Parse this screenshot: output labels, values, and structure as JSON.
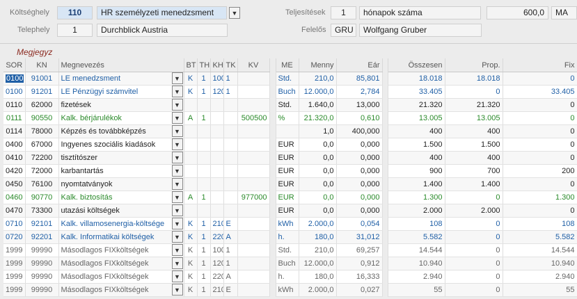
{
  "header": {
    "cost_center_label": "Költséghely",
    "cost_center_code": "110",
    "cost_center_name": "HR személyzeti menedzsment",
    "site_label": "Telephely",
    "site_code": "1",
    "site_name": "Durchblick Austria",
    "performance_label": "Teljesítések",
    "performance_value": "1",
    "performance_unit_name": "hónapok száma",
    "performance_amount": "600,0",
    "performance_unit": "MA",
    "responsible_label": "Felelős",
    "responsible_code": "GRU",
    "responsible_name": "Wolfgang Gruber"
  },
  "note_label": "Megjegyz",
  "columns": [
    "SOR",
    "KN",
    "Megnevezés",
    "BT",
    "TH",
    "KH",
    "TK",
    "KV",
    "ME",
    "Menny",
    "Eár",
    "Összesen",
    "Prop.",
    "Fix"
  ],
  "rows": [
    {
      "sor": "0100",
      "kn": "91001",
      "name": "LE menedzsment",
      "bt": "K",
      "th": "1",
      "kh": "100",
      "tk": "1",
      "kv": "",
      "me": "Std.",
      "menny": "210,0",
      "ear": "85,801",
      "osszesen": "18.018",
      "prop": "18.018",
      "fix": "0",
      "color": "blue",
      "sel": true
    },
    {
      "sor": "0100",
      "kn": "91201",
      "name": "LE Pénzügyi számvitel",
      "bt": "K",
      "th": "1",
      "kh": "120",
      "tk": "1",
      "kv": "",
      "me": "Buch",
      "menny": "12.000,0",
      "ear": "2,784",
      "osszesen": "33.405",
      "prop": "0",
      "fix": "33.405",
      "color": "blue"
    },
    {
      "sor": "0110",
      "kn": "62000",
      "name": "fizetések",
      "bt": "",
      "th": "",
      "kh": "",
      "tk": "",
      "kv": "",
      "me": "Std.",
      "menny": "1.640,0",
      "ear": "13,000",
      "osszesen": "21.320",
      "prop": "21.320",
      "fix": "0",
      "color": "black"
    },
    {
      "sor": "0111",
      "kn": "90550",
      "name": "Kalk. bérjárulékok",
      "bt": "A",
      "th": "1",
      "kh": "",
      "tk": "",
      "kv": "500500",
      "me": "%",
      "menny": "21.320,0",
      "ear": "0,610",
      "osszesen": "13.005",
      "prop": "13.005",
      "fix": "0",
      "color": "green"
    },
    {
      "sor": "0114",
      "kn": "78000",
      "name": "Képzés és továbbképzés",
      "bt": "",
      "th": "",
      "kh": "",
      "tk": "",
      "kv": "",
      "me": "",
      "menny": "1,0",
      "ear": "400,000",
      "osszesen": "400",
      "prop": "400",
      "fix": "0",
      "color": "black"
    },
    {
      "sor": "0400",
      "kn": "67000",
      "name": "Ingyenes szociális kiadások",
      "bt": "",
      "th": "",
      "kh": "",
      "tk": "",
      "kv": "",
      "me": "EUR",
      "menny": "0,0",
      "ear": "0,000",
      "osszesen": "1.500",
      "prop": "1.500",
      "fix": "0",
      "color": "black"
    },
    {
      "sor": "0410",
      "kn": "72200",
      "name": "tisztítószer",
      "bt": "",
      "th": "",
      "kh": "",
      "tk": "",
      "kv": "",
      "me": "EUR",
      "menny": "0,0",
      "ear": "0,000",
      "osszesen": "400",
      "prop": "400",
      "fix": "0",
      "color": "black"
    },
    {
      "sor": "0420",
      "kn": "72000",
      "name": "karbantartás",
      "bt": "",
      "th": "",
      "kh": "",
      "tk": "",
      "kv": "",
      "me": "EUR",
      "menny": "0,0",
      "ear": "0,000",
      "osszesen": "900",
      "prop": "700",
      "fix": "200",
      "color": "black"
    },
    {
      "sor": "0450",
      "kn": "76100",
      "name": "nyomtatványok",
      "bt": "",
      "th": "",
      "kh": "",
      "tk": "",
      "kv": "",
      "me": "EUR",
      "menny": "0,0",
      "ear": "0,000",
      "osszesen": "1.400",
      "prop": "1.400",
      "fix": "0",
      "color": "black"
    },
    {
      "sor": "0460",
      "kn": "90770",
      "name": "Kalk. biztosítás",
      "bt": "A",
      "th": "1",
      "kh": "",
      "tk": "",
      "kv": "977000",
      "me": "EUR",
      "menny": "0,0",
      "ear": "0,000",
      "osszesen": "1.300",
      "prop": "0",
      "fix": "1.300",
      "color": "green"
    },
    {
      "sor": "0470",
      "kn": "73300",
      "name": "utazási költségek",
      "bt": "",
      "th": "",
      "kh": "",
      "tk": "",
      "kv": "",
      "me": "EUR",
      "menny": "0,0",
      "ear": "0,000",
      "osszesen": "2.000",
      "prop": "2.000",
      "fix": "0",
      "color": "black"
    },
    {
      "sor": "0710",
      "kn": "92101",
      "name": "Kalk. villamosenergia-költsége",
      "bt": "K",
      "th": "1",
      "kh": "210",
      "tk": "E",
      "kv": "",
      "me": "kWh",
      "menny": "2.000,0",
      "ear": "0,054",
      "osszesen": "108",
      "prop": "0",
      "fix": "108",
      "color": "blue"
    },
    {
      "sor": "0720",
      "kn": "92201",
      "name": "Kalk. Informatikai költségek",
      "bt": "K",
      "th": "1",
      "kh": "220",
      "tk": "A",
      "kv": "",
      "me": "h.",
      "menny": "180,0",
      "ear": "31,012",
      "osszesen": "5.582",
      "prop": "0",
      "fix": "5.582",
      "color": "blue"
    },
    {
      "sor": "1999",
      "kn": "99990",
      "name": "Másodlagos FIXköltségek",
      "bt": "K",
      "th": "1",
      "kh": "100",
      "tk": "1",
      "kv": "",
      "me": "Std.",
      "menny": "210,0",
      "ear": "69,257",
      "osszesen": "14.544",
      "prop": "0",
      "fix": "14.544",
      "color": "gray"
    },
    {
      "sor": "1999",
      "kn": "99990",
      "name": "Másodlagos FIXköltségek",
      "bt": "K",
      "th": "1",
      "kh": "120",
      "tk": "1",
      "kv": "",
      "me": "Buch",
      "menny": "12.000,0",
      "ear": "0,912",
      "osszesen": "10.940",
      "prop": "0",
      "fix": "10.940",
      "color": "gray"
    },
    {
      "sor": "1999",
      "kn": "99990",
      "name": "Másodlagos FIXköltségek",
      "bt": "K",
      "th": "1",
      "kh": "220",
      "tk": "A",
      "kv": "",
      "me": "h.",
      "menny": "180,0",
      "ear": "16,333",
      "osszesen": "2.940",
      "prop": "0",
      "fix": "2.940",
      "color": "gray"
    },
    {
      "sor": "1999",
      "kn": "99990",
      "name": "Másodlagos FIXköltségek",
      "bt": "K",
      "th": "1",
      "kh": "210",
      "tk": "E",
      "kv": "",
      "me": "kWh",
      "menny": "2.000,0",
      "ear": "0,027",
      "osszesen": "55",
      "prop": "0",
      "fix": "55",
      "color": "gray"
    }
  ],
  "icons": {
    "dropdown": "chevron-down-icon"
  },
  "colors": {
    "blue_text": "#1f5fa6",
    "green_text": "#2a8a2a",
    "gray_text": "#666666",
    "highlight_field": "#d8e6f5"
  }
}
